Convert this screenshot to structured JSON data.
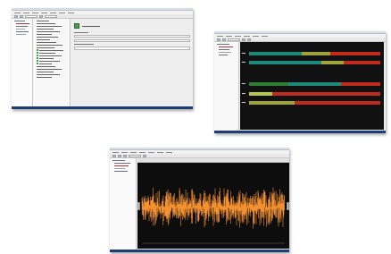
{
  "screens": [
    {
      "name": "configuration-view",
      "tree_items": 6,
      "list_items": 22
    },
    {
      "name": "timeline-view",
      "tracks": [
        [
          {
            "start": 0.0,
            "end": 0.4,
            "color": "teal"
          },
          {
            "start": 0.4,
            "end": 0.62,
            "color": "olive"
          },
          {
            "start": 0.62,
            "end": 1.0,
            "color": "red"
          }
        ],
        [
          {
            "start": 0.0,
            "end": 0.55,
            "color": "teal"
          },
          {
            "start": 0.55,
            "end": 0.72,
            "color": "olive"
          },
          {
            "start": 0.72,
            "end": 1.0,
            "color": "red"
          }
        ],
        [
          {
            "start": 0.0,
            "end": 0.3,
            "color": "green"
          },
          {
            "start": 0.3,
            "end": 0.7,
            "color": "teal"
          },
          {
            "start": 0.7,
            "end": 1.0,
            "color": "red"
          }
        ],
        [
          {
            "start": 0.0,
            "end": 0.18,
            "color": "lime"
          },
          {
            "start": 0.18,
            "end": 1.0,
            "color": "red"
          }
        ],
        [
          {
            "start": 0.0,
            "end": 0.35,
            "color": "olive"
          },
          {
            "start": 0.35,
            "end": 1.0,
            "color": "red"
          }
        ]
      ]
    },
    {
      "name": "waveform-view",
      "amplitude": 0.72
    }
  ],
  "colors": {
    "teal": "#1d8a79",
    "olive": "#9fa43a",
    "red": "#c12a1f",
    "green": "#2f7d34",
    "lime": "#b8c94a",
    "wave": "#f3902f",
    "statusbar": "#1c3d78"
  }
}
